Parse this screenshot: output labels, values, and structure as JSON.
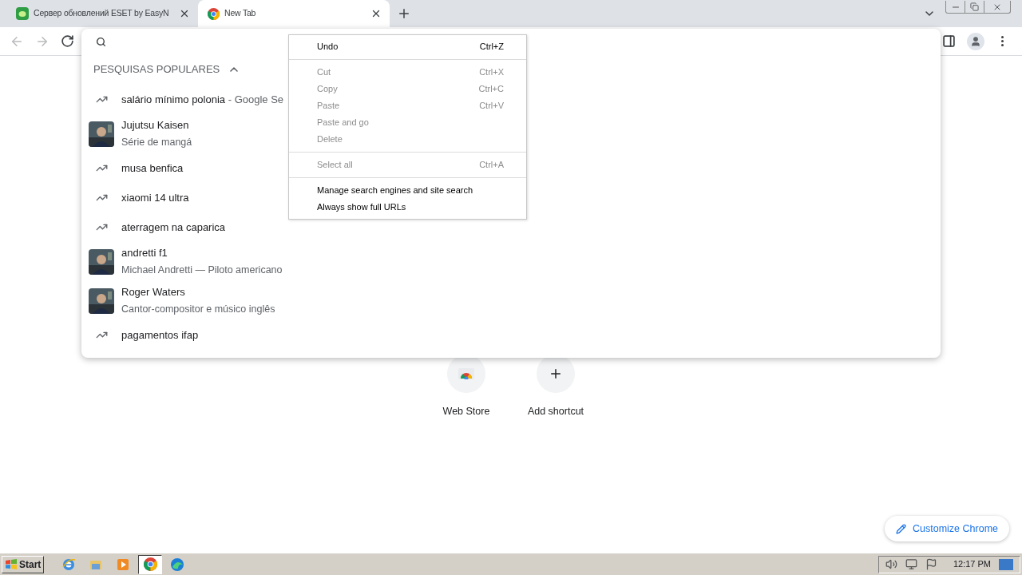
{
  "tabs": [
    {
      "title": "Сервер обновлений ESET by EasyN",
      "kind": "eset",
      "selected": false
    },
    {
      "title": "New Tab",
      "kind": "chrome",
      "selected": true
    }
  ],
  "omnibox_dropdown": {
    "section_header": "PESQUISAS POPULARES",
    "expanded": true,
    "suggestions": [
      {
        "kind": "trend",
        "text": "salário mínimo polonia",
        "suffix": " - Google Se"
      },
      {
        "kind": "entity",
        "text": "Jujutsu Kaisen",
        "subtitle": "Série de mangá"
      },
      {
        "kind": "trend",
        "text": "musa benfica"
      },
      {
        "kind": "trend",
        "text": "xiaomi 14 ultra"
      },
      {
        "kind": "trend",
        "text": "aterragem na caparica"
      },
      {
        "kind": "entity",
        "text": "andretti f1",
        "subtitle": "Michael Andretti — Piloto americano"
      },
      {
        "kind": "entity",
        "text": "Roger Waters",
        "subtitle": "Cantor-compositor e músico inglês"
      },
      {
        "kind": "trend",
        "text": "pagamentos ifap"
      }
    ]
  },
  "context_menu": [
    [
      {
        "label": "Undo",
        "shortcut": "Ctrl+Z",
        "disabled": false
      }
    ],
    [
      {
        "label": "Cut",
        "shortcut": "Ctrl+X",
        "disabled": true
      },
      {
        "label": "Copy",
        "shortcut": "Ctrl+C",
        "disabled": true
      },
      {
        "label": "Paste",
        "shortcut": "Ctrl+V",
        "disabled": true
      },
      {
        "label": "Paste and go",
        "disabled": true
      },
      {
        "label": "Delete",
        "disabled": true
      }
    ],
    [
      {
        "label": "Select all",
        "shortcut": "Ctrl+A",
        "disabled": true
      }
    ],
    [
      {
        "label": "Manage search engines and site search",
        "disabled": false
      },
      {
        "label": "Always show full URLs",
        "disabled": false
      }
    ]
  ],
  "shortcuts": [
    {
      "kind": "webstore",
      "label": "Web Store"
    },
    {
      "kind": "add",
      "label": "Add shortcut"
    }
  ],
  "customize_button": "Customize Chrome",
  "taskbar": {
    "start": "Start",
    "apps": [
      {
        "kind": "ie",
        "selected": false
      },
      {
        "kind": "folder",
        "selected": false
      },
      {
        "kind": "media",
        "selected": false
      },
      {
        "kind": "chrome",
        "selected": true
      },
      {
        "kind": "edge",
        "selected": false
      }
    ],
    "clock": "12:17 PM"
  }
}
